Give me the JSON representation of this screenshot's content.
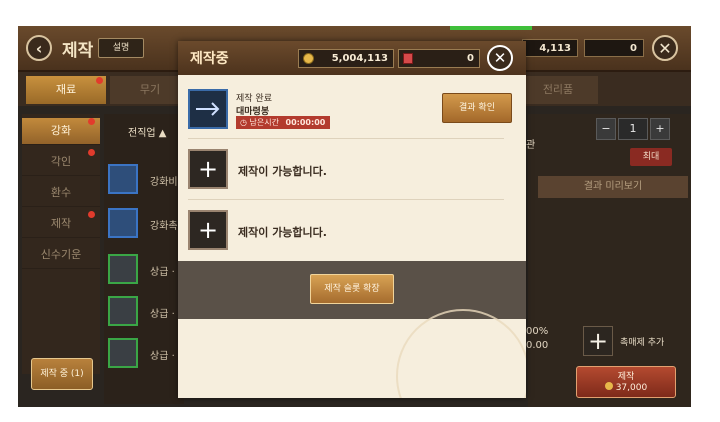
{
  "topbar": {
    "title": "제작",
    "help_label": "설명",
    "gold": "4,113",
    "tickets": "0",
    "back_icon": "chevron-left-icon",
    "close_icon": "close-icon"
  },
  "tabs": [
    {
      "label": "재료",
      "active": true
    },
    {
      "label": "무기",
      "active": false
    },
    {
      "label": "",
      "active": false
    },
    {
      "label": "",
      "active": false
    },
    {
      "label": "",
      "active": false
    },
    {
      "label": "전리품",
      "active": false
    }
  ],
  "sidebar": {
    "items": [
      {
        "label": "강화",
        "active": true
      },
      {
        "label": "각인",
        "active": false
      },
      {
        "label": "환수",
        "active": false
      },
      {
        "label": "제작",
        "active": false
      },
      {
        "label": "신수기운",
        "active": false
      }
    ],
    "crafting_button": "제작 중 (1)"
  },
  "list": {
    "header": "전직업",
    "rows": [
      {
        "label": "강화비"
      },
      {
        "label": "강화촉"
      },
      {
        "label": "상급 ·"
      },
      {
        "label": "상급 ·"
      },
      {
        "label": "상급 ·"
      }
    ]
  },
  "right": {
    "quantity": "1",
    "max_label": "최대",
    "preview_label": "결과 미리보기",
    "fragment_label": "관",
    "rate1": "00%",
    "rate2": "0.00",
    "catalyst_label": "촉매제 추가",
    "make_label": "제작",
    "make_cost": "37,000"
  },
  "modal": {
    "title": "제작중",
    "gold": "5,004,113",
    "tickets": "0",
    "slots": [
      {
        "status": "제작 완료",
        "item": "대마령봉",
        "timer_label": "남은시간",
        "timer": "00:00:00",
        "button": "결과 확인"
      },
      {
        "text": "제작이 가능합니다."
      },
      {
        "text": "제작이 가능합니다."
      }
    ],
    "expand_button": "제작 슬롯 확장"
  }
}
